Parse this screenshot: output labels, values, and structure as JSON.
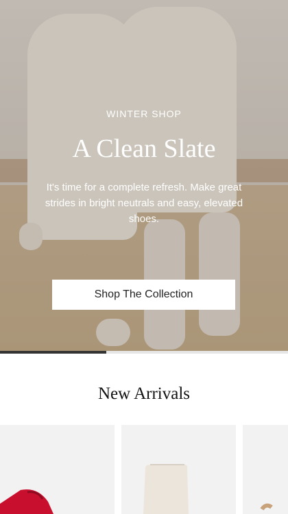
{
  "hero": {
    "eyebrow": "WINTER SHOP",
    "title": "A Clean Slate",
    "body": "It's time for a complete refresh. Make great strides in bright neutrals and easy, elevated shoes.",
    "cta_label": "Shop The Collection",
    "carousel_progress_fraction": 0.37
  },
  "new_arrivals": {
    "title": "New Arrivals",
    "cards": [
      {
        "item": "red-heel-image"
      },
      {
        "item": "cream-boot-image"
      },
      {
        "item": "partial-product-image"
      }
    ]
  },
  "colors": {
    "accent_red": "#c8102e",
    "boot_cream": "#ece5dc",
    "card_bg": "#f2f2f2"
  }
}
